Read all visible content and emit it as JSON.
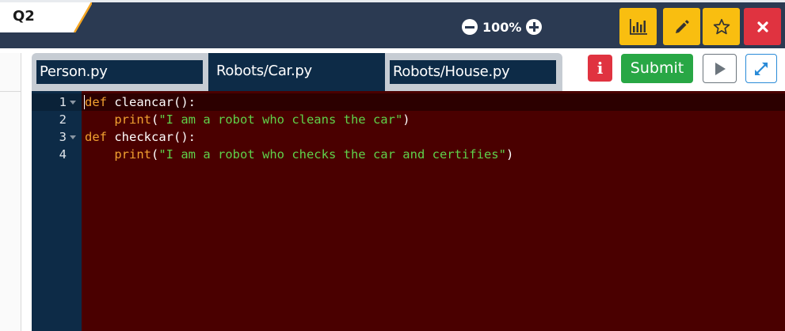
{
  "question_tab": {
    "label": "Q2"
  },
  "zoom": {
    "value": "100%"
  },
  "toolbar": {
    "buttons": [
      {
        "name": "stats",
        "icon": "bar-chart-icon",
        "color": "#f9be10"
      },
      {
        "name": "edit",
        "icon": "pencil-icon",
        "color": "#f9be10"
      },
      {
        "name": "favorite",
        "icon": "star-icon",
        "color": "#f9be10"
      },
      {
        "name": "close",
        "icon": "close-icon",
        "color": "#e03340"
      }
    ]
  },
  "file_tabs": [
    {
      "label": "Person.py",
      "active": false
    },
    {
      "label": "Robots/Car.py",
      "active": true
    },
    {
      "label": "Robots/House.py",
      "active": false
    }
  ],
  "actions": {
    "info_label": "i",
    "submit_label": "Submit"
  },
  "editor": {
    "background": "#4a0000",
    "lines": [
      {
        "number": "1",
        "fold": true,
        "tokens": [
          {
            "t": "kw",
            "v": "def"
          },
          {
            "t": "plain",
            "v": " cleancar():"
          }
        ]
      },
      {
        "number": "2",
        "fold": false,
        "tokens": [
          {
            "t": "plain",
            "v": "    "
          },
          {
            "t": "fn",
            "v": "print"
          },
          {
            "t": "plain",
            "v": "("
          },
          {
            "t": "str",
            "v": "\"I am a robot who cleans the car\""
          },
          {
            "t": "plain",
            "v": ")"
          }
        ]
      },
      {
        "number": "3",
        "fold": true,
        "tokens": [
          {
            "t": "kw",
            "v": "def"
          },
          {
            "t": "plain",
            "v": " checkcar():"
          }
        ]
      },
      {
        "number": "4",
        "fold": false,
        "tokens": [
          {
            "t": "plain",
            "v": "    "
          },
          {
            "t": "fn",
            "v": "print"
          },
          {
            "t": "plain",
            "v": "("
          },
          {
            "t": "str",
            "v": "\"I am a robot who checks the car and certifies\""
          },
          {
            "t": "plain",
            "v": ")"
          }
        ]
      }
    ]
  }
}
